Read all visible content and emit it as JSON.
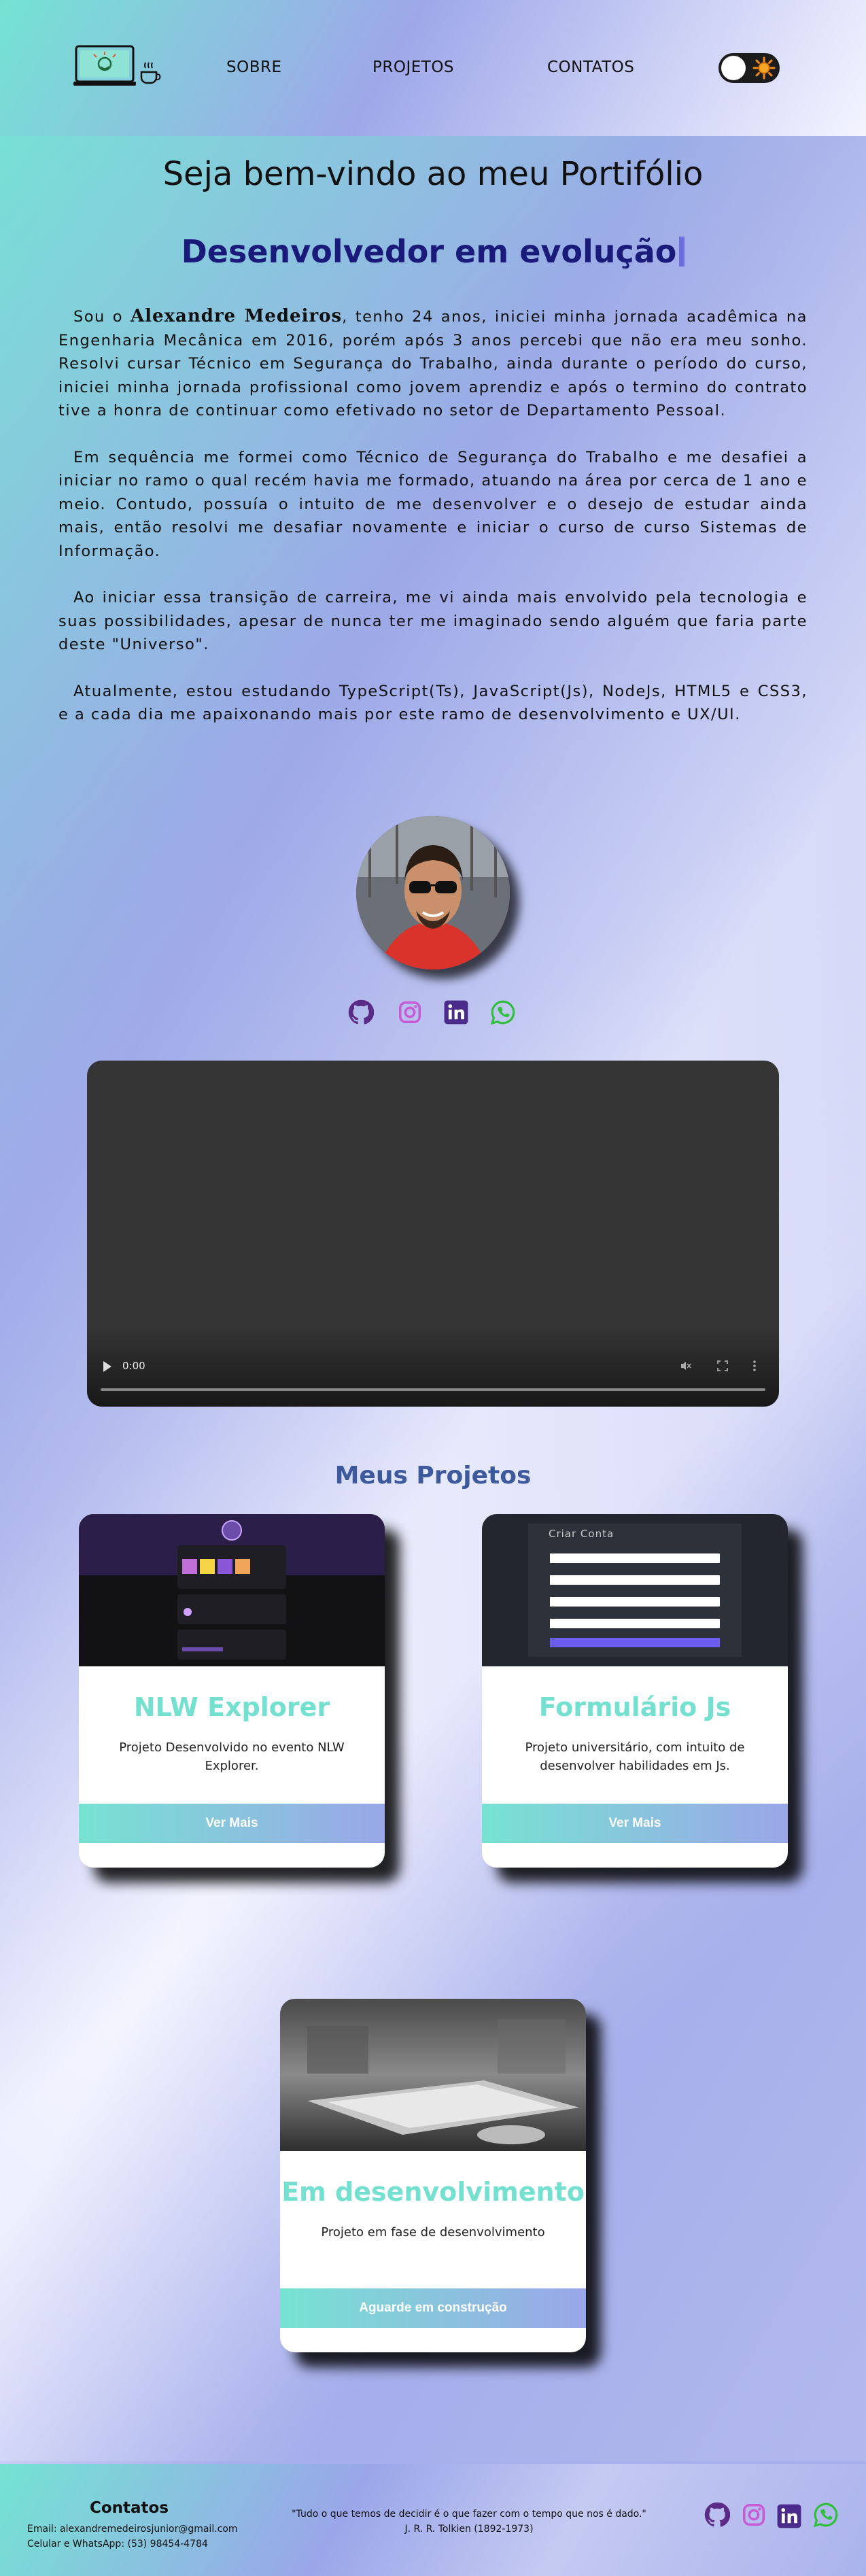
{
  "colors": {
    "accent_teal": "#74e0cf",
    "accent_lavender": "#9aa6e8",
    "role_navy": "#1a1a7a",
    "projects_title": "#3d5a9c",
    "github": "#5b2a86",
    "instagram": "#c85ad6",
    "linkedin": "#4a2a8a",
    "whatsapp": "#2fbf3a"
  },
  "header": {
    "logo_icon": "laptop-coffee-logo-icon",
    "nav": [
      "SOBRE",
      "PROJETOS",
      "CONTATOS"
    ],
    "theme_toggle_icon": "sun-icon"
  },
  "intro": {
    "welcome": "Seja bem-vindo ao meu Portifólio",
    "role": "Desenvolvedor em evolução",
    "bio_p1_pre": "Sou o ",
    "bio_name": "Alexandre Medeiros",
    "bio_p1_post": ", tenho 24 anos, iniciei minha jornada acadêmica na Engenharia Mecânica em 2016, porém após 3 anos percebi que não era meu sonho. Resolvi cursar Técnico em Segurança do Trabalho, ainda durante o período do curso, iniciei minha jornada profissional como jovem aprendiz e após o termino do contrato tive a honra de continuar como efetivado no setor de Departamento Pessoal.",
    "bio_p2": "Em sequência me formei como Técnico de Segurança do Trabalho e me desafiei a iniciar no ramo o qual recém havia me formado, atuando na área por cerca de 1 ano e meio. Contudo, possuía o intuito de me desenvolver e o desejo de estudar ainda mais, então resolvi me desafiar novamente e iniciar o curso de curso Sistemas de Informação.",
    "bio_p3": "Ao iniciar essa transição de carreira, me vi ainda mais envolvido pela tecnologia e suas possibilidades, apesar de nunca ter me imaginado sendo alguém que faria parte deste \"Universo\".",
    "bio_p4": "Atualmente, estou estudando TypeScript(Ts), JavaScript(Js), NodeJs, HTML5 e CSS3, e a cada dia me apaixonando mais por este ramo de desenvolvimento e UX/UI."
  },
  "social": [
    "github-icon",
    "instagram-icon",
    "linkedin-icon",
    "whatsapp-icon"
  ],
  "video": {
    "time": "0:00",
    "controls": [
      "volume-icon",
      "fullscreen-icon",
      "more-options-icon"
    ]
  },
  "projects": {
    "title": "Meus Projetos",
    "cards": [
      {
        "title": "NLW Explorer",
        "description": "Projeto Desenvolvido no evento NLW Explorer.",
        "button": "Ver Mais"
      },
      {
        "title": "Formulário Js",
        "description": "Projeto universitário, com intuito de desenvolver habilidades em Js.",
        "button": "Ver Mais",
        "thumb_heading": "Criar Conta"
      },
      {
        "title": "Em desenvolvimento",
        "description": "Projeto em fase de desenvolvimento",
        "button": "Aguarde em construção"
      }
    ]
  },
  "footer": {
    "contacts_title": "Contatos",
    "email": "Email: alexandremedeirosjunior@gmail.com",
    "phone": "Celular e WhatsApp: (53) 98454-4784",
    "quote": "\"Tudo o que temos de decidir é o que fazer com o tempo que nos é dado.\"",
    "author": "J. R. R. Tolkien (1892-1973)"
  }
}
